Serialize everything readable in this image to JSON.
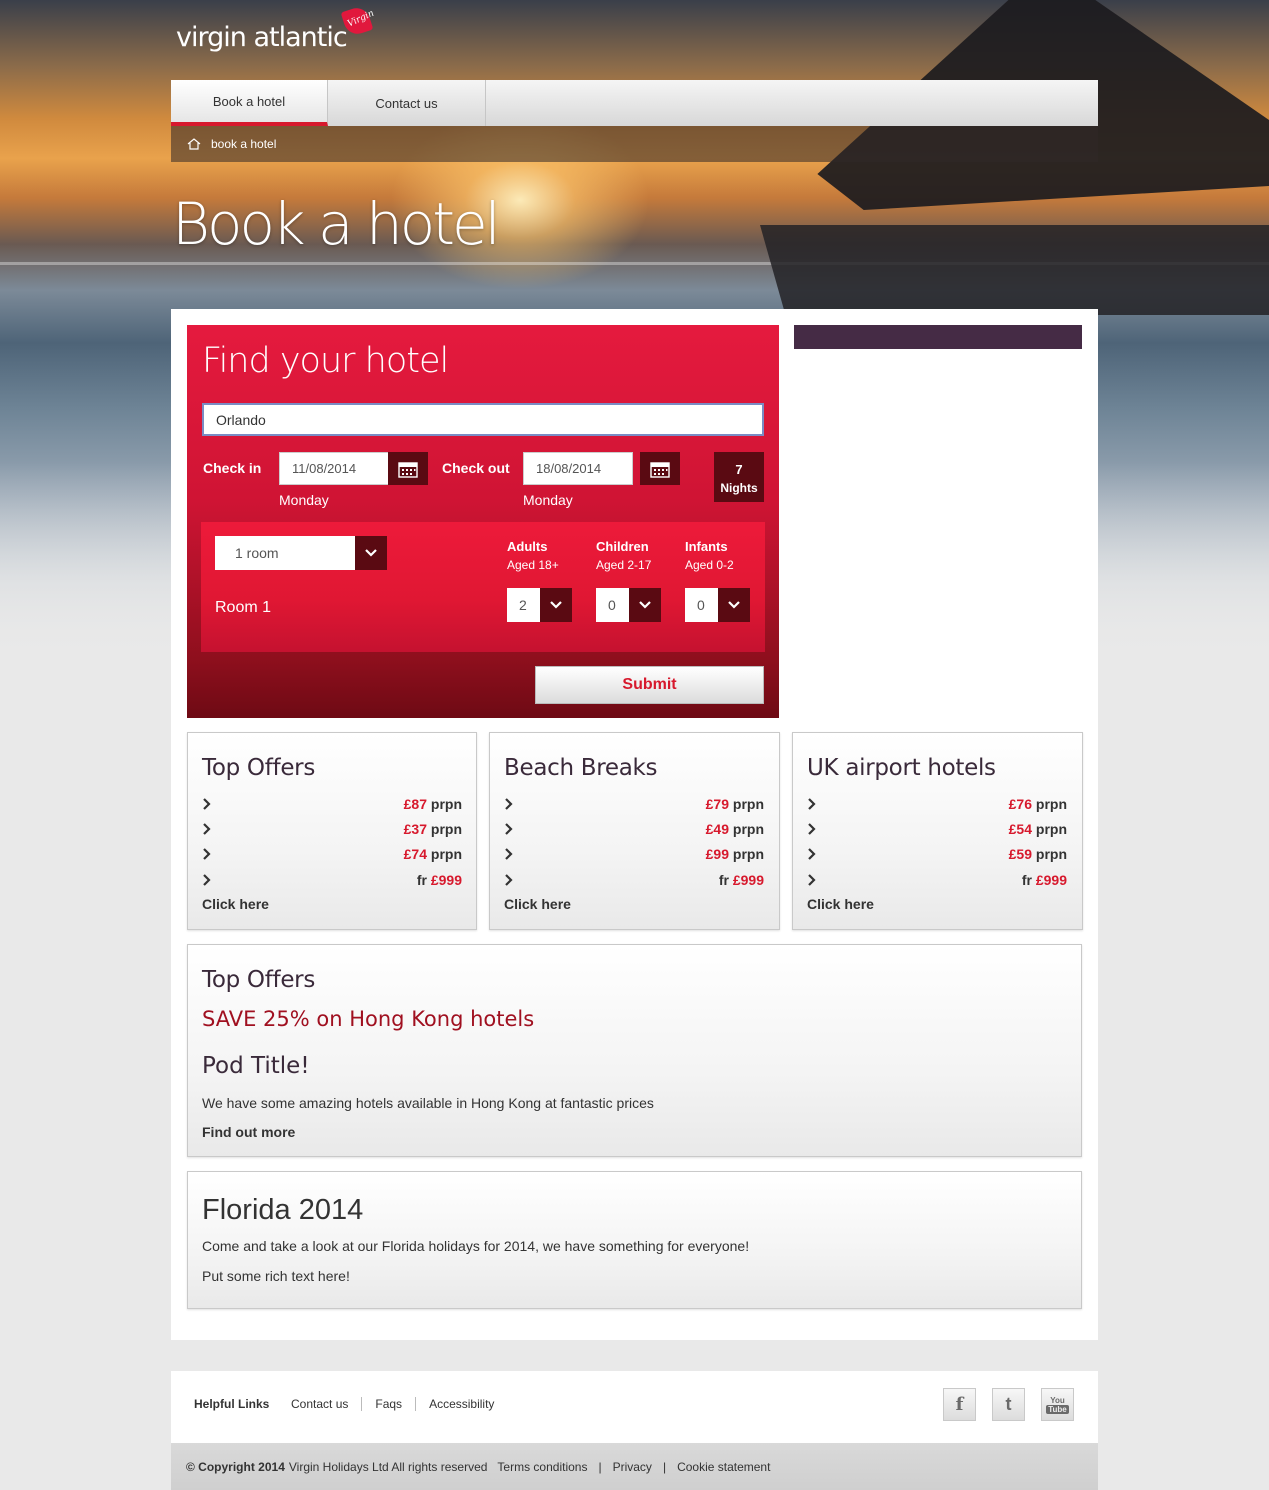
{
  "brand": {
    "name": "virgin atlantic",
    "badge": "Virgin"
  },
  "nav": {
    "items": [
      "Book a hotel",
      "Contact us"
    ]
  },
  "breadcrumb": {
    "label": "book a hotel"
  },
  "page": {
    "title": "Book a hotel"
  },
  "search": {
    "title": "Find your hotel",
    "destination": "Orlando",
    "checkin_label": "Check in",
    "checkin_value": "11/08/2014",
    "checkin_day": "Monday",
    "checkout_label": "Check out",
    "checkout_value": "18/08/2014",
    "checkout_day": "Monday",
    "nights_count": "7",
    "nights_label": "Nights",
    "rooms_value": "1 room",
    "room_label": "Room 1",
    "adults_label": "Adults",
    "adults_sub": "Aged 18+",
    "adults_value": "2",
    "children_label": "Children",
    "children_sub": "Aged 2-17",
    "children_value": "0",
    "infants_label": "Infants",
    "infants_sub": "Aged 0-2",
    "infants_value": "0",
    "submit_label": "Submit"
  },
  "offer_pods": [
    {
      "title": "Top Offers",
      "rows": [
        {
          "prefix": "",
          "amount": "£87",
          "suffix": " prpn"
        },
        {
          "prefix": "",
          "amount": "£37",
          "suffix": " prpn"
        },
        {
          "prefix": "",
          "amount": "£74",
          "suffix": " prpn"
        },
        {
          "prefix": "fr ",
          "amount": "£999",
          "suffix": ""
        }
      ],
      "link": "Click here"
    },
    {
      "title": "Beach Breaks",
      "rows": [
        {
          "prefix": "",
          "amount": "£79",
          "suffix": " prpn"
        },
        {
          "prefix": "",
          "amount": "£49",
          "suffix": " prpn"
        },
        {
          "prefix": "",
          "amount": "£99",
          "suffix": " prpn"
        },
        {
          "prefix": "fr ",
          "amount": "£999",
          "suffix": ""
        }
      ],
      "link": "Click here"
    },
    {
      "title": "UK airport hotels",
      "rows": [
        {
          "prefix": "",
          "amount": "£76",
          "suffix": " prpn"
        },
        {
          "prefix": "",
          "amount": "£54",
          "suffix": " prpn"
        },
        {
          "prefix": "",
          "amount": "£59",
          "suffix": " prpn"
        },
        {
          "prefix": "fr ",
          "amount": "£999",
          "suffix": ""
        }
      ],
      "link": "Click here"
    }
  ],
  "promo": {
    "title": "Top Offers",
    "headline": "SAVE 25% on Hong Kong hotels",
    "pod_title": "Pod Title!",
    "text": "We have some amazing hotels available in Hong Kong at fantastic prices",
    "link": "Find out more"
  },
  "florida": {
    "title": "Florida 2014",
    "text1": "Come and take a look at our Florida holidays for 2014, we have something for everyone!",
    "text2": "Put some rich text here!"
  },
  "footer": {
    "helpful_links": "Helpful Links",
    "links": [
      "Contact us",
      "Faqs",
      "Accessibility"
    ],
    "social": {
      "facebook": "f",
      "twitter": "t",
      "youtube_top": "You",
      "youtube_bottom": "Tube"
    }
  },
  "copyright": {
    "bold": "© Copyright 2014",
    "text": "Virgin Holidays Ltd All rights reserved",
    "links": [
      "Terms conditions",
      "Privacy",
      "Cookie statement"
    ]
  },
  "colors": {
    "accent": "#d7192d",
    "dark_red": "#5a0a12",
    "purple": "#452b45"
  }
}
